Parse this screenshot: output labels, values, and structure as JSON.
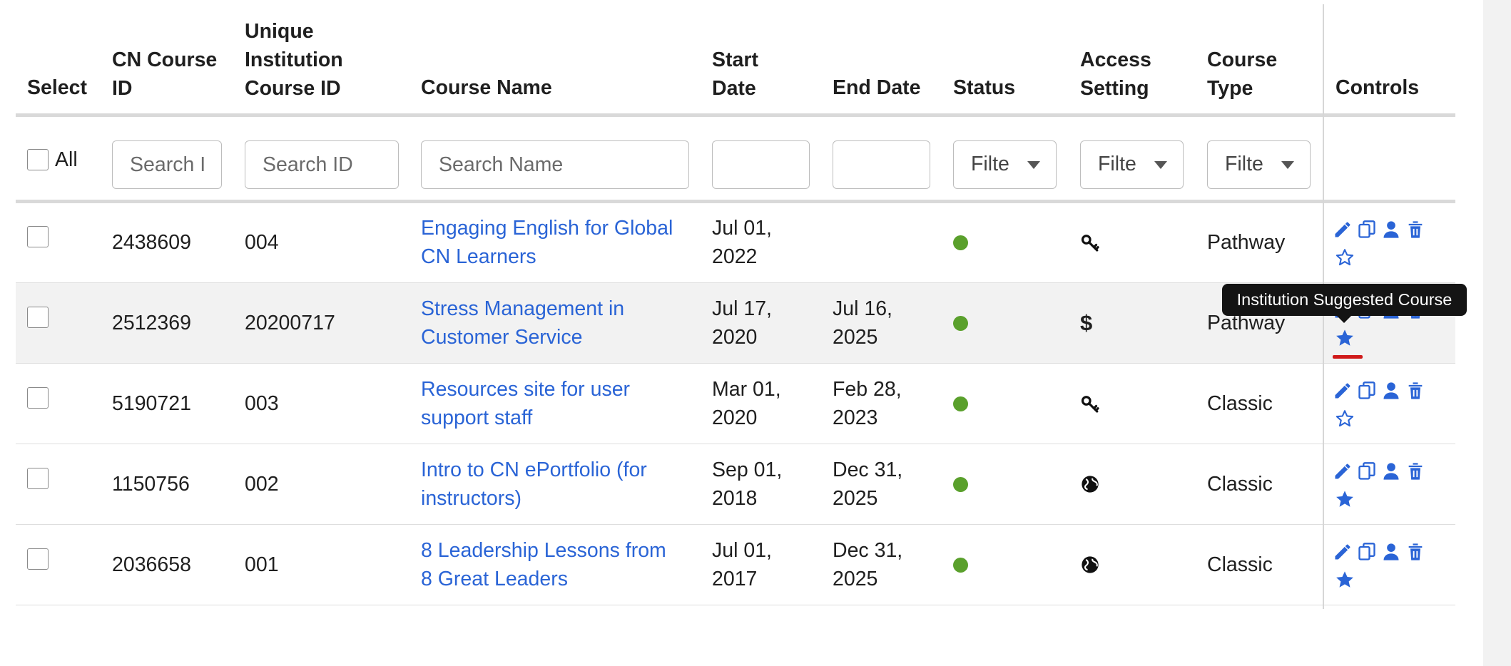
{
  "headers": {
    "select": "Select",
    "cn_course_id": [
      "CN Course",
      "ID"
    ],
    "unique_id": [
      "Unique",
      "Institution",
      "Course ID"
    ],
    "course_name": "Course Name",
    "start_date": [
      "Start",
      "Date"
    ],
    "end_date": "End Date",
    "status": "Status",
    "access": [
      "Access",
      "Setting"
    ],
    "course_type": [
      "Course",
      "Type"
    ],
    "controls": "Controls"
  },
  "filters": {
    "all_label": "All",
    "cn_id_placeholder": "Search ID",
    "unique_id_placeholder": "Search ID",
    "name_placeholder": "Search Name",
    "status_select": "Filte",
    "access_select": "Filte",
    "type_select": "Filte"
  },
  "rows": [
    {
      "cn_id": "2438609",
      "unique_id": "004",
      "name": [
        "Engaging English for Global",
        "CN Learners"
      ],
      "start": [
        "Jul 01,",
        "2022"
      ],
      "end": [
        "",
        ""
      ],
      "status_color": "#5aa02c",
      "access": "key-icon",
      "type": "Pathway",
      "suggested": false,
      "shaded": false
    },
    {
      "cn_id": "2512369",
      "unique_id": "20200717",
      "name": [
        "Stress Management in",
        "Customer Service"
      ],
      "start": [
        "Jul 17,",
        "2020"
      ],
      "end": [
        "Jul 16,",
        "2025"
      ],
      "status_color": "#5aa02c",
      "access": "$",
      "type": "Pathway",
      "suggested": true,
      "shaded": true
    },
    {
      "cn_id": "5190721",
      "unique_id": "003",
      "name": [
        "Resources site for user",
        "support staff"
      ],
      "start": [
        "Mar 01,",
        "2020"
      ],
      "end": [
        "Feb 28,",
        "2023"
      ],
      "status_color": "#5aa02c",
      "access": "key-icon",
      "type": "Classic",
      "suggested": false,
      "shaded": false
    },
    {
      "cn_id": "1150756",
      "unique_id": "002",
      "name": [
        "Intro to CN ePortfolio (for",
        "instructors)"
      ],
      "start": [
        "Sep 01,",
        "2018"
      ],
      "end": [
        "Dec 31,",
        "2025"
      ],
      "status_color": "#5aa02c",
      "access": "globe-icon",
      "type": "Classic",
      "suggested": true,
      "shaded": false
    },
    {
      "cn_id": "2036658",
      "unique_id": "001",
      "name": [
        "8 Leadership Lessons from",
        "8 Great Leaders"
      ],
      "start": [
        "Jul 01,",
        "2017"
      ],
      "end": [
        "Dec 31,",
        "2025"
      ],
      "status_color": "#5aa02c",
      "access": "globe-icon",
      "type": "Classic",
      "suggested": true,
      "shaded": false
    }
  ],
  "tooltip": "Institution Suggested Course",
  "colors": {
    "link": "#2a64d6",
    "status_active": "#5aa02c",
    "tooltip_bg": "#141414",
    "highlight": "#d01a1a"
  }
}
